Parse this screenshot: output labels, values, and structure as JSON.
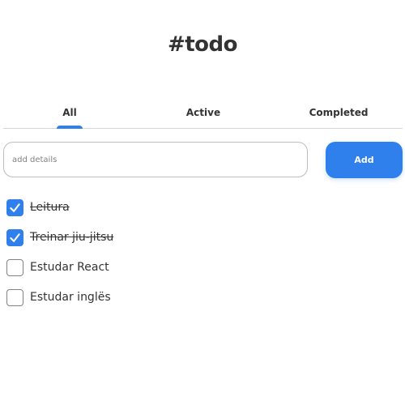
{
  "header": {
    "title": "#todo"
  },
  "tabs": [
    {
      "label": "All",
      "active": true
    },
    {
      "label": "Active",
      "active": false
    },
    {
      "label": "Completed",
      "active": false
    }
  ],
  "new_task": {
    "placeholder": "add details",
    "value": "",
    "add_label": "Add"
  },
  "tasks": [
    {
      "label": "Leitura",
      "completed": true
    },
    {
      "label": "Treinar jiu-jitsu",
      "completed": true
    },
    {
      "label": "Estudar React",
      "completed": false
    },
    {
      "label": "Estudar inglës",
      "completed": false
    }
  ],
  "colors": {
    "accent": "#2F80ED",
    "text": "#333333",
    "border": "#BDBDBD",
    "placeholder": "#828282"
  }
}
